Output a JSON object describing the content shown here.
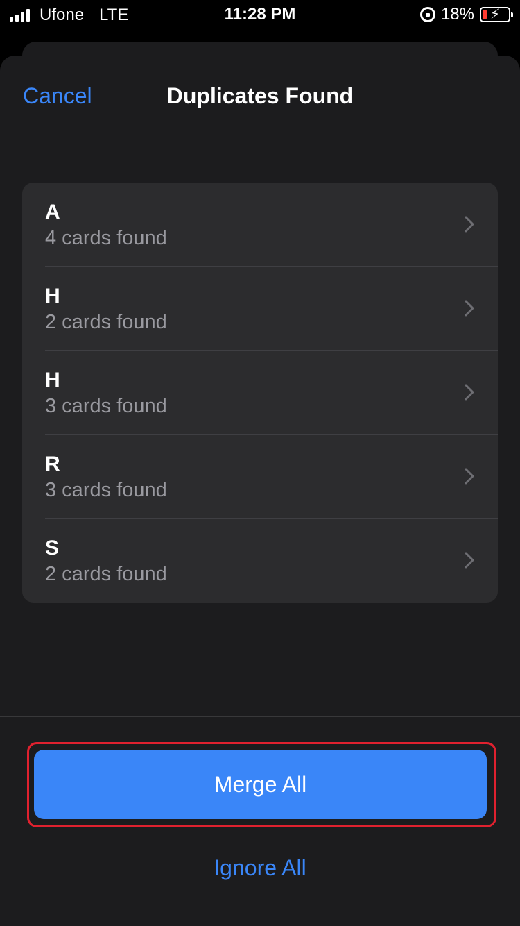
{
  "status_bar": {
    "carrier": "Ufone",
    "network": "LTE",
    "time": "11:28 PM",
    "battery_percent": "18%",
    "battery_level": 0.18,
    "battery_color": "#ff3b30",
    "signal_icon": "signal-bars-icon",
    "rotation_lock_icon": "rotation-lock-icon",
    "battery_icon": "battery-charging-icon"
  },
  "nav": {
    "cancel_label": "Cancel",
    "title": "Duplicates Found"
  },
  "duplicates": [
    {
      "name": "A",
      "detail": "4 cards found"
    },
    {
      "name": "H",
      "detail": "2 cards found"
    },
    {
      "name": "H",
      "detail": "3 cards found"
    },
    {
      "name": "R",
      "detail": "3 cards found"
    },
    {
      "name": "S",
      "detail": "2 cards found"
    }
  ],
  "actions": {
    "merge_all_label": "Merge All",
    "ignore_all_label": "Ignore All"
  },
  "colors": {
    "accent": "#3a86f8",
    "highlight": "#e0212f",
    "background": "#1c1c1e",
    "card": "#2c2c2e"
  }
}
